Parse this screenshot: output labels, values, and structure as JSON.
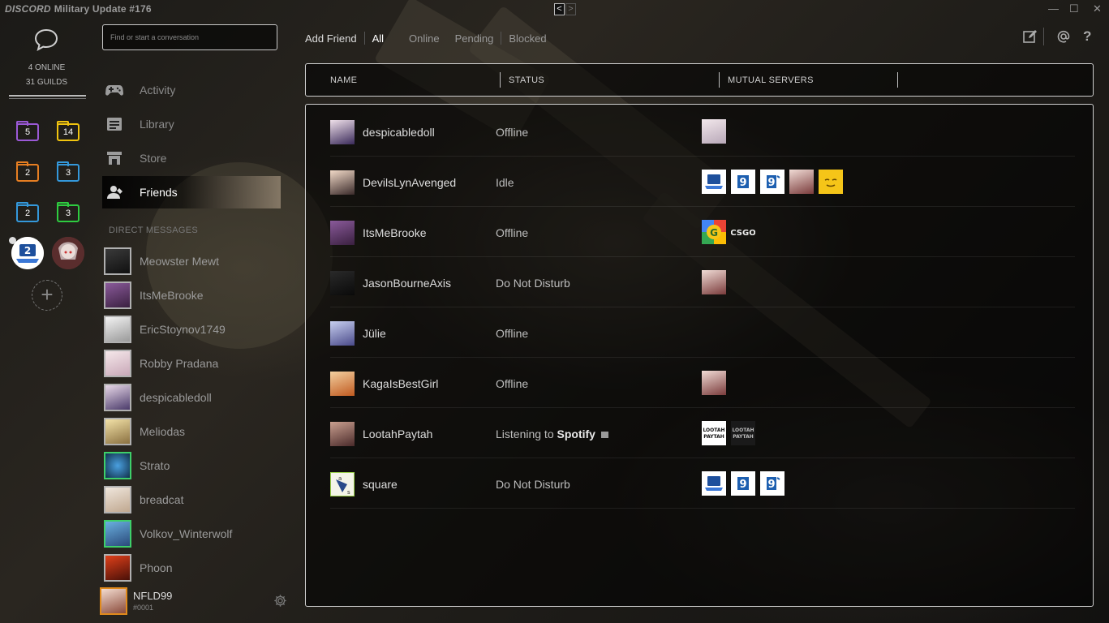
{
  "window": {
    "brand": "DISCORD",
    "title": "Military Update #176",
    "back_arrow": "<",
    "forward_arrow": ">",
    "minimize": "—",
    "maximize": "☐",
    "close": "✕"
  },
  "guild_bar": {
    "online": "4 ONLINE",
    "guilds": "31 GUILDS",
    "folders": [
      {
        "count": "5",
        "color": "#9b59d6"
      },
      {
        "count": "14",
        "color": "#f1c40f"
      },
      {
        "count": "2",
        "color": "#e67e22"
      },
      {
        "count": "3",
        "color": "#3498db"
      },
      {
        "count": "2",
        "color": "#3498db"
      },
      {
        "count": "3",
        "color": "#2ecc40"
      }
    ],
    "add_server": "+"
  },
  "channels": {
    "search_placeholder": "Find or start a conversation",
    "nav": [
      {
        "label": "Activity",
        "icon": "gamepad-icon"
      },
      {
        "label": "Library",
        "icon": "library-icon"
      },
      {
        "label": "Store",
        "icon": "store-icon"
      },
      {
        "label": "Friends",
        "icon": "friends-icon"
      }
    ],
    "dm_header": "DIRECT MESSAGES",
    "dms": [
      {
        "name": "Meowster Mewt"
      },
      {
        "name": "ItsMeBrooke"
      },
      {
        "name": "EricStoynov1749"
      },
      {
        "name": "Robby Pradana"
      },
      {
        "name": "despicabledoll"
      },
      {
        "name": "Meliodas"
      },
      {
        "name": "Strato"
      },
      {
        "name": "breadcat"
      },
      {
        "name": "Volkov_Winterwolf"
      },
      {
        "name": "Phoon"
      }
    ],
    "user": {
      "name": "NFLD99",
      "tag": "#0001"
    }
  },
  "tabs": {
    "add_friend": "Add Friend",
    "all": "All",
    "online": "Online",
    "pending": "Pending",
    "blocked": "Blocked"
  },
  "columns": {
    "name": "NAME",
    "status": "STATUS",
    "mutual": "MUTUAL SERVERS"
  },
  "friends": [
    {
      "name": "despicabledoll",
      "status": "Offline",
      "servers": [
        "anime-server"
      ]
    },
    {
      "name": "DevilsLynAvenged",
      "status": "Idle",
      "servers": [
        "laptop-server",
        "g-server",
        "g-server",
        "anime-server",
        "smiley-server"
      ]
    },
    {
      "name": "ItsMeBrooke",
      "status": "Offline",
      "servers": [
        "g-colored-server",
        "csgo-server"
      ]
    },
    {
      "name": "JasonBourneAxis",
      "status": "Do Not Disturb",
      "servers": [
        "anime-server"
      ]
    },
    {
      "name": "Jülie",
      "status": "Offline",
      "servers": []
    },
    {
      "name": "KagaIsBestGirl",
      "status": "Offline",
      "servers": [
        "anime-server"
      ]
    },
    {
      "name": "LootahPaytah",
      "status": "Listening to ",
      "status_app": "Spotify",
      "servers": [
        "lootah-server",
        "lootah-dark-server"
      ]
    },
    {
      "name": "square",
      "status": "Do Not Disturb",
      "servers": [
        "laptop-server",
        "g-server",
        "g-server"
      ]
    }
  ]
}
